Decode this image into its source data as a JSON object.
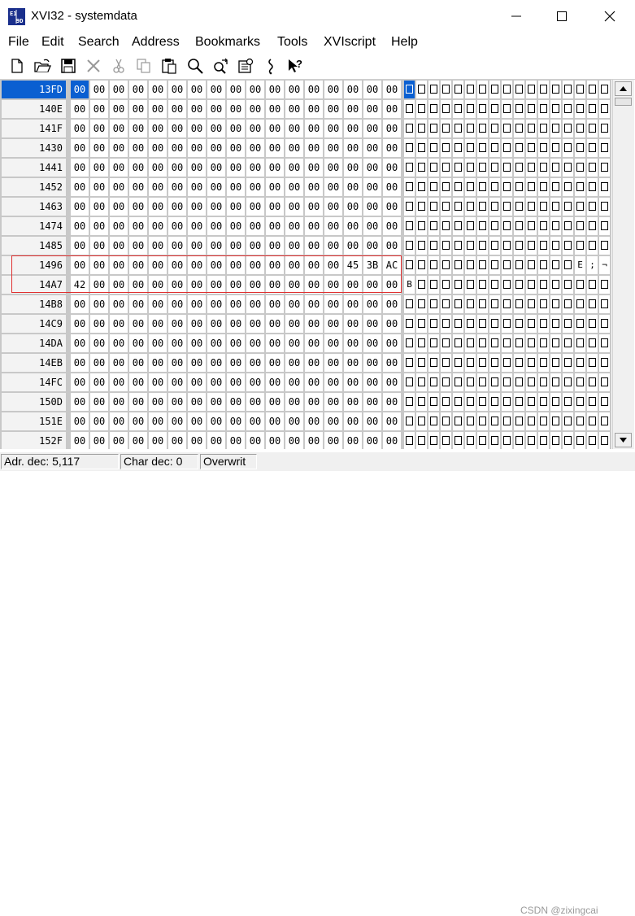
{
  "window": {
    "title": "XVI32 - systemdata"
  },
  "menu": [
    "File",
    "Edit",
    "Search",
    "Address",
    "Bookmarks",
    "Tools",
    "XVIscript",
    "Help"
  ],
  "toolbar": [
    "new-file-icon",
    "open-folder-icon",
    "save-icon",
    "delete-icon",
    "cut-icon",
    "copy-icon",
    "paste-icon",
    "find-icon",
    "replace-icon",
    "settings-icon",
    "script-icon",
    "help-icon"
  ],
  "rows": [
    {
      "addr": "13FD",
      "hex": [
        "00",
        "00",
        "00",
        "00",
        "00",
        "00",
        "00",
        "00",
        "00",
        "00",
        "00",
        "00",
        "00",
        "00",
        "00",
        "00",
        "00"
      ],
      "chars": [
        "",
        "",
        "",
        "",
        "",
        "",
        "",
        "",
        "",
        "",
        "",
        "",
        "",
        "",
        "",
        "",
        ""
      ]
    },
    {
      "addr": "140E",
      "hex": [
        "00",
        "00",
        "00",
        "00",
        "00",
        "00",
        "00",
        "00",
        "00",
        "00",
        "00",
        "00",
        "00",
        "00",
        "00",
        "00",
        "00"
      ],
      "chars": [
        "",
        "",
        "",
        "",
        "",
        "",
        "",
        "",
        "",
        "",
        "",
        "",
        "",
        "",
        "",
        "",
        ""
      ]
    },
    {
      "addr": "141F",
      "hex": [
        "00",
        "00",
        "00",
        "00",
        "00",
        "00",
        "00",
        "00",
        "00",
        "00",
        "00",
        "00",
        "00",
        "00",
        "00",
        "00",
        "00"
      ],
      "chars": [
        "",
        "",
        "",
        "",
        "",
        "",
        "",
        "",
        "",
        "",
        "",
        "",
        "",
        "",
        "",
        "",
        ""
      ]
    },
    {
      "addr": "1430",
      "hex": [
        "00",
        "00",
        "00",
        "00",
        "00",
        "00",
        "00",
        "00",
        "00",
        "00",
        "00",
        "00",
        "00",
        "00",
        "00",
        "00",
        "00"
      ],
      "chars": [
        "",
        "",
        "",
        "",
        "",
        "",
        "",
        "",
        "",
        "",
        "",
        "",
        "",
        "",
        "",
        "",
        ""
      ]
    },
    {
      "addr": "1441",
      "hex": [
        "00",
        "00",
        "00",
        "00",
        "00",
        "00",
        "00",
        "00",
        "00",
        "00",
        "00",
        "00",
        "00",
        "00",
        "00",
        "00",
        "00"
      ],
      "chars": [
        "",
        "",
        "",
        "",
        "",
        "",
        "",
        "",
        "",
        "",
        "",
        "",
        "",
        "",
        "",
        "",
        ""
      ]
    },
    {
      "addr": "1452",
      "hex": [
        "00",
        "00",
        "00",
        "00",
        "00",
        "00",
        "00",
        "00",
        "00",
        "00",
        "00",
        "00",
        "00",
        "00",
        "00",
        "00",
        "00"
      ],
      "chars": [
        "",
        "",
        "",
        "",
        "",
        "",
        "",
        "",
        "",
        "",
        "",
        "",
        "",
        "",
        "",
        "",
        ""
      ]
    },
    {
      "addr": "1463",
      "hex": [
        "00",
        "00",
        "00",
        "00",
        "00",
        "00",
        "00",
        "00",
        "00",
        "00",
        "00",
        "00",
        "00",
        "00",
        "00",
        "00",
        "00"
      ],
      "chars": [
        "",
        "",
        "",
        "",
        "",
        "",
        "",
        "",
        "",
        "",
        "",
        "",
        "",
        "",
        "",
        "",
        ""
      ]
    },
    {
      "addr": "1474",
      "hex": [
        "00",
        "00",
        "00",
        "00",
        "00",
        "00",
        "00",
        "00",
        "00",
        "00",
        "00",
        "00",
        "00",
        "00",
        "00",
        "00",
        "00"
      ],
      "chars": [
        "",
        "",
        "",
        "",
        "",
        "",
        "",
        "",
        "",
        "",
        "",
        "",
        "",
        "",
        "",
        "",
        ""
      ]
    },
    {
      "addr": "1485",
      "hex": [
        "00",
        "00",
        "00",
        "00",
        "00",
        "00",
        "00",
        "00",
        "00",
        "00",
        "00",
        "00",
        "00",
        "00",
        "00",
        "00",
        "00"
      ],
      "chars": [
        "",
        "",
        "",
        "",
        "",
        "",
        "",
        "",
        "",
        "",
        "",
        "",
        "",
        "",
        "",
        "",
        ""
      ]
    },
    {
      "addr": "1496",
      "hex": [
        "00",
        "00",
        "00",
        "00",
        "00",
        "00",
        "00",
        "00",
        "00",
        "00",
        "00",
        "00",
        "00",
        "00",
        "45",
        "3B",
        "AC"
      ],
      "chars": [
        "",
        "",
        "",
        "",
        "",
        "",
        "",
        "",
        "",
        "",
        "",
        "",
        "",
        "",
        "E",
        ";",
        "¬"
      ]
    },
    {
      "addr": "14A7",
      "hex": [
        "42",
        "00",
        "00",
        "00",
        "00",
        "00",
        "00",
        "00",
        "00",
        "00",
        "00",
        "00",
        "00",
        "00",
        "00",
        "00",
        "00"
      ],
      "chars": [
        "B",
        "",
        "",
        "",
        "",
        "",
        "",
        "",
        "",
        "",
        "",
        "",
        "",
        "",
        "",
        "",
        ""
      ]
    },
    {
      "addr": "14B8",
      "hex": [
        "00",
        "00",
        "00",
        "00",
        "00",
        "00",
        "00",
        "00",
        "00",
        "00",
        "00",
        "00",
        "00",
        "00",
        "00",
        "00",
        "00"
      ],
      "chars": [
        "",
        "",
        "",
        "",
        "",
        "",
        "",
        "",
        "",
        "",
        "",
        "",
        "",
        "",
        "",
        "",
        ""
      ]
    },
    {
      "addr": "14C9",
      "hex": [
        "00",
        "00",
        "00",
        "00",
        "00",
        "00",
        "00",
        "00",
        "00",
        "00",
        "00",
        "00",
        "00",
        "00",
        "00",
        "00",
        "00"
      ],
      "chars": [
        "",
        "",
        "",
        "",
        "",
        "",
        "",
        "",
        "",
        "",
        "",
        "",
        "",
        "",
        "",
        "",
        ""
      ]
    },
    {
      "addr": "14DA",
      "hex": [
        "00",
        "00",
        "00",
        "00",
        "00",
        "00",
        "00",
        "00",
        "00",
        "00",
        "00",
        "00",
        "00",
        "00",
        "00",
        "00",
        "00"
      ],
      "chars": [
        "",
        "",
        "",
        "",
        "",
        "",
        "",
        "",
        "",
        "",
        "",
        "",
        "",
        "",
        "",
        "",
        ""
      ]
    },
    {
      "addr": "14EB",
      "hex": [
        "00",
        "00",
        "00",
        "00",
        "00",
        "00",
        "00",
        "00",
        "00",
        "00",
        "00",
        "00",
        "00",
        "00",
        "00",
        "00",
        "00"
      ],
      "chars": [
        "",
        "",
        "",
        "",
        "",
        "",
        "",
        "",
        "",
        "",
        "",
        "",
        "",
        "",
        "",
        "",
        ""
      ]
    },
    {
      "addr": "14FC",
      "hex": [
        "00",
        "00",
        "00",
        "00",
        "00",
        "00",
        "00",
        "00",
        "00",
        "00",
        "00",
        "00",
        "00",
        "00",
        "00",
        "00",
        "00"
      ],
      "chars": [
        "",
        "",
        "",
        "",
        "",
        "",
        "",
        "",
        "",
        "",
        "",
        "",
        "",
        "",
        "",
        "",
        ""
      ]
    },
    {
      "addr": "150D",
      "hex": [
        "00",
        "00",
        "00",
        "00",
        "00",
        "00",
        "00",
        "00",
        "00",
        "00",
        "00",
        "00",
        "00",
        "00",
        "00",
        "00",
        "00"
      ],
      "chars": [
        "",
        "",
        "",
        "",
        "",
        "",
        "",
        "",
        "",
        "",
        "",
        "",
        "",
        "",
        "",
        "",
        ""
      ]
    },
    {
      "addr": "151E",
      "hex": [
        "00",
        "00",
        "00",
        "00",
        "00",
        "00",
        "00",
        "00",
        "00",
        "00",
        "00",
        "00",
        "00",
        "00",
        "00",
        "00",
        "00"
      ],
      "chars": [
        "",
        "",
        "",
        "",
        "",
        "",
        "",
        "",
        "",
        "",
        "",
        "",
        "",
        "",
        "",
        "",
        ""
      ]
    },
    {
      "addr": "152F",
      "hex": [
        "00",
        "00",
        "00",
        "00",
        "00",
        "00",
        "00",
        "00",
        "00",
        "00",
        "00",
        "00",
        "00",
        "00",
        "00",
        "00",
        "00"
      ],
      "chars": [
        "",
        "",
        "",
        "",
        "",
        "",
        "",
        "",
        "",
        "",
        "",
        "",
        "",
        "",
        "",
        "",
        ""
      ]
    }
  ],
  "selection": {
    "row": 0,
    "col": 0
  },
  "status": {
    "adr": "Adr. dec: 5,117",
    "char": "Char dec: 0",
    "mode": "Overwrit"
  },
  "watermark": "CSDN @zixingcai",
  "colors": {
    "selection": "#0a5fd1",
    "highlight": "#e03030"
  }
}
